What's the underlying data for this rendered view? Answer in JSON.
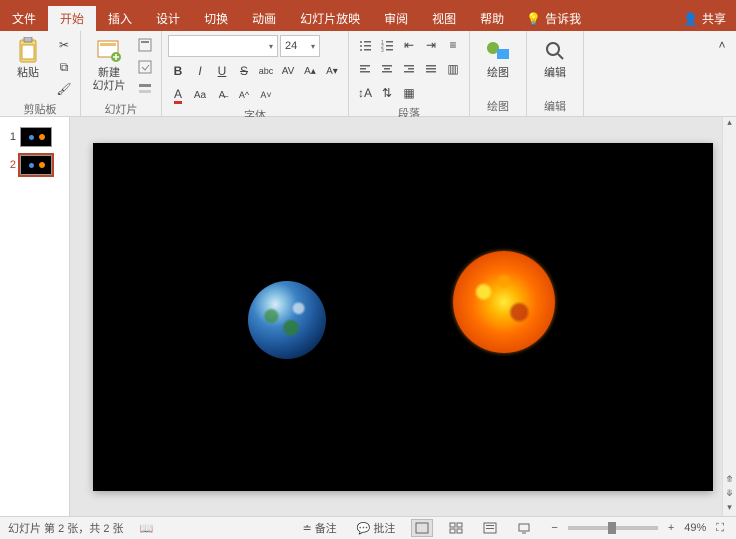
{
  "tabs": {
    "file": "文件",
    "home": "开始",
    "insert": "插入",
    "design": "设计",
    "transitions": "切换",
    "animations": "动画",
    "slideshow": "幻灯片放映",
    "review": "审阅",
    "view": "视图",
    "help": "帮助",
    "tellme": "告诉我",
    "share": "共享"
  },
  "ribbon": {
    "clipboard": {
      "label": "剪贴板",
      "paste": "粘贴"
    },
    "slides": {
      "label": "幻灯片",
      "newslide": "新建\n幻灯片"
    },
    "font": {
      "label": "字体",
      "family": "",
      "size": "24"
    },
    "paragraph": {
      "label": "段落"
    },
    "drawing": {
      "label": "绘图",
      "draw": "绘图"
    },
    "editing": {
      "label": "编辑",
      "edit": "编辑"
    }
  },
  "thumbs": [
    {
      "n": "1"
    },
    {
      "n": "2"
    }
  ],
  "status": {
    "slideinfo": "幻灯片 第 2 张，共 2 张",
    "notes": "备注",
    "comments": "批注",
    "zoom": "49%"
  }
}
